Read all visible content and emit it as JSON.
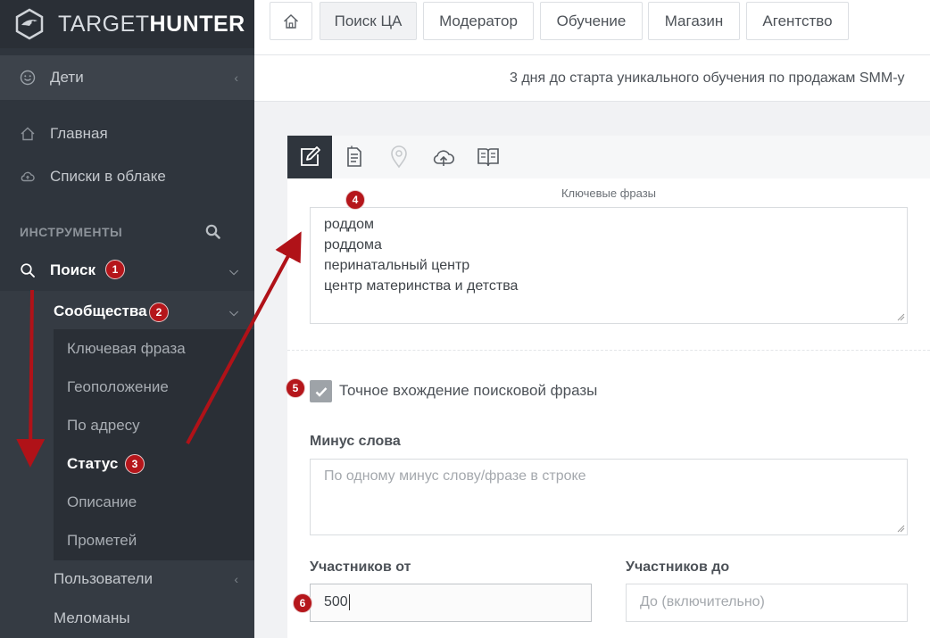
{
  "brand": {
    "part1": "TARGET",
    "part2": "HUNTER"
  },
  "sidebar": {
    "kids": "Дети",
    "home": "Главная",
    "cloud": "Списки в облаке",
    "tools": "ИНСТРУМЕНТЫ",
    "search": "Поиск",
    "communities": "Сообщества",
    "sub_items": [
      "Ключевая фраза",
      "Геоположение",
      "По адресу",
      "Статус",
      "Описание",
      "Прометей"
    ],
    "users": "Пользователи",
    "music": "Меломаны"
  },
  "topnav": {
    "buttons": [
      "Поиск ЦА",
      "Модератор",
      "Обучение",
      "Магазин",
      "Агентство"
    ]
  },
  "announcement": "3 дня до старта уникального обучения по продажам SMM-у",
  "form": {
    "keywords_label": "Ключевые фразы",
    "keywords": [
      "роддом",
      "роддома",
      "перинатальный центр",
      "центр материнства и детства"
    ],
    "exact_label": "Точное вхождение поисковой фразы",
    "minus_label": "Минус слова",
    "minus_placeholder": "По одному минус слову/фразе в строке",
    "from_label": "Участников от",
    "from_value": "500",
    "to_label": "Участников до",
    "to_placeholder": "До (включительно)"
  },
  "badges": [
    "1",
    "2",
    "3",
    "4",
    "5",
    "6"
  ],
  "colors": {
    "sidebar": "#2f353d",
    "badge": "#b5161b",
    "arrow": "#b01218"
  }
}
